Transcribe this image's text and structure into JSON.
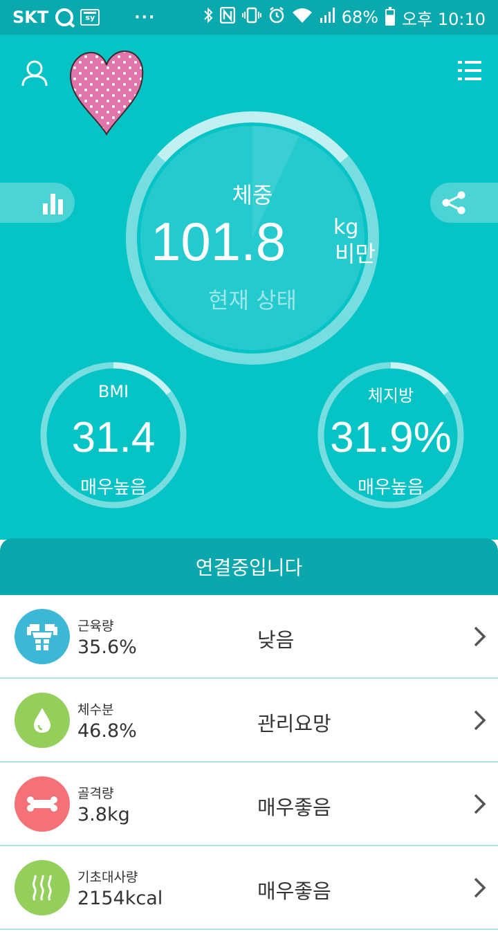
{
  "status_bar": {
    "carrier": "SKT",
    "sy_label": "sy",
    "dots": "···",
    "battery_percent": "68%",
    "time": "오후 10:10"
  },
  "weight": {
    "label": "체중",
    "value": "101.8",
    "unit": "kg",
    "status": "비만",
    "subtitle": "현재 상태"
  },
  "bmi": {
    "label": "BMI",
    "value": "31.4",
    "status": "매우높음"
  },
  "body_fat": {
    "label": "체지방",
    "value": "31.9%",
    "status": "매우높음"
  },
  "connection": {
    "text": "연결중입니다"
  },
  "metrics": [
    {
      "name": "근육량",
      "value": "35.6%",
      "status": "낮음",
      "icon": "muscle-icon",
      "color": "#3cb7d6"
    },
    {
      "name": "체수분",
      "value": "46.8%",
      "status": "관리요망",
      "icon": "water-drop-icon",
      "color": "#94cf5c"
    },
    {
      "name": "골격량",
      "value": "3.8kg",
      "status": "매우좋음",
      "icon": "bone-icon",
      "color": "#f47277"
    },
    {
      "name": "기초대사량",
      "value": "2154kcal",
      "status": "매우좋음",
      "icon": "heat-waves-icon",
      "color": "#94cf5c"
    }
  ],
  "colors": {
    "primary": "#06c3c6",
    "dark": "#0aa8ad"
  }
}
